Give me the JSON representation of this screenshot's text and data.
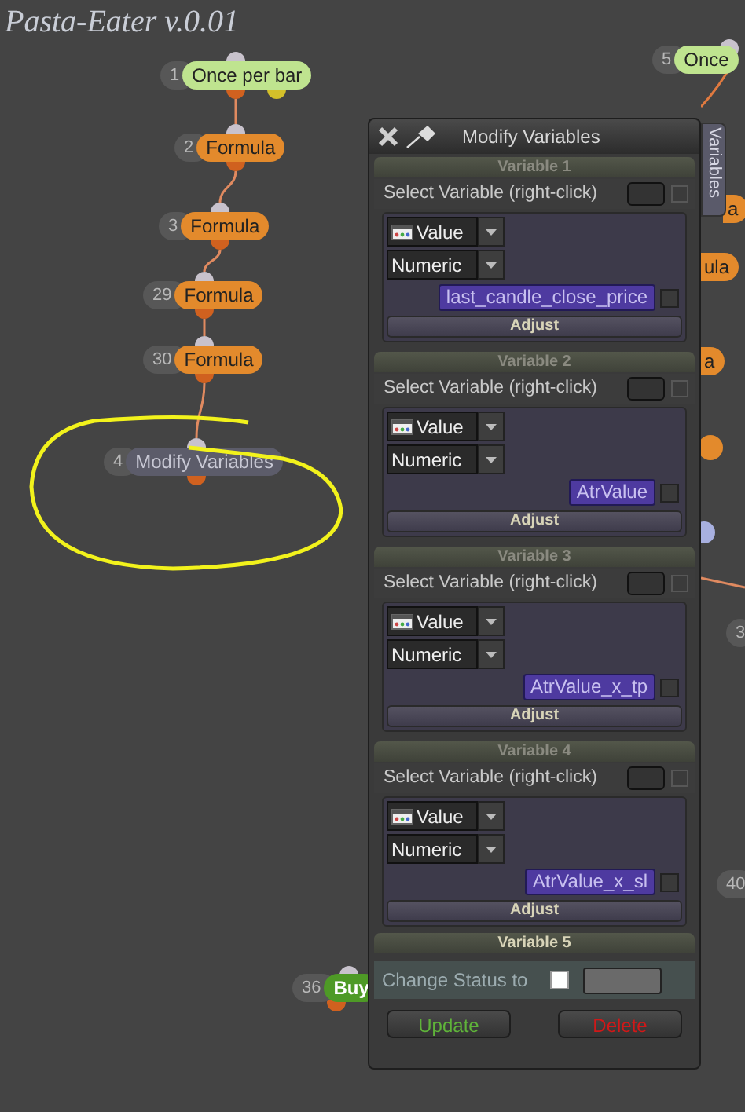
{
  "title": "Pasta-Eater v.0.01",
  "nodes": [
    {
      "number": "1",
      "label": "Once per bar",
      "kind": "trigger"
    },
    {
      "number": "2",
      "label": "Formula",
      "kind": "formula"
    },
    {
      "number": "3",
      "label": "Formula",
      "kind": "formula"
    },
    {
      "number": "29",
      "label": "Formula",
      "kind": "formula"
    },
    {
      "number": "30",
      "label": "Formula",
      "kind": "formula"
    },
    {
      "number": "4",
      "label": "Modify Variables",
      "kind": "modify"
    },
    {
      "number": "36",
      "label": "Buy",
      "kind": "buy"
    },
    {
      "number": "5",
      "label": "Once",
      "kind": "trigger"
    },
    {
      "label": "a",
      "kind": "formula"
    },
    {
      "label": "ula",
      "kind": "formula"
    },
    {
      "label": "a",
      "kind": "formula"
    },
    {
      "number": "3",
      "kind": "plain"
    },
    {
      "number": "40",
      "kind": "plain"
    }
  ],
  "panel": {
    "title": "Modify Variables",
    "side_tab": "Variables",
    "variables": [
      {
        "header": "Variable 1",
        "select_label": "Select Variable (right-click)",
        "source": "Value",
        "type": "Numeric",
        "name": "last_candle_close_price",
        "select_checked": false,
        "checked": false,
        "adjust": "Adjust"
      },
      {
        "header": "Variable 2",
        "select_label": "Select Variable (right-click)",
        "source": "Value",
        "type": "Numeric",
        "name": "AtrValue",
        "select_checked": false,
        "checked": false,
        "adjust": "Adjust"
      },
      {
        "header": "Variable 3",
        "select_label": "Select Variable (right-click)",
        "source": "Value",
        "type": "Numeric",
        "name": "AtrValue_x_tp",
        "select_checked": false,
        "checked": false,
        "adjust": "Adjust"
      },
      {
        "header": "Variable 4",
        "select_label": "Select Variable (right-click)",
        "source": "Value",
        "type": "Numeric",
        "name": "AtrValue_x_sl",
        "select_checked": false,
        "checked": false,
        "adjust": "Adjust"
      }
    ],
    "collapsed_header": "Variable 5",
    "status": {
      "label": "Change Status to",
      "checked": false
    },
    "buttons": [
      {
        "label": "Update",
        "kind": "update"
      },
      {
        "label": "Delete",
        "kind": "delete"
      }
    ]
  }
}
